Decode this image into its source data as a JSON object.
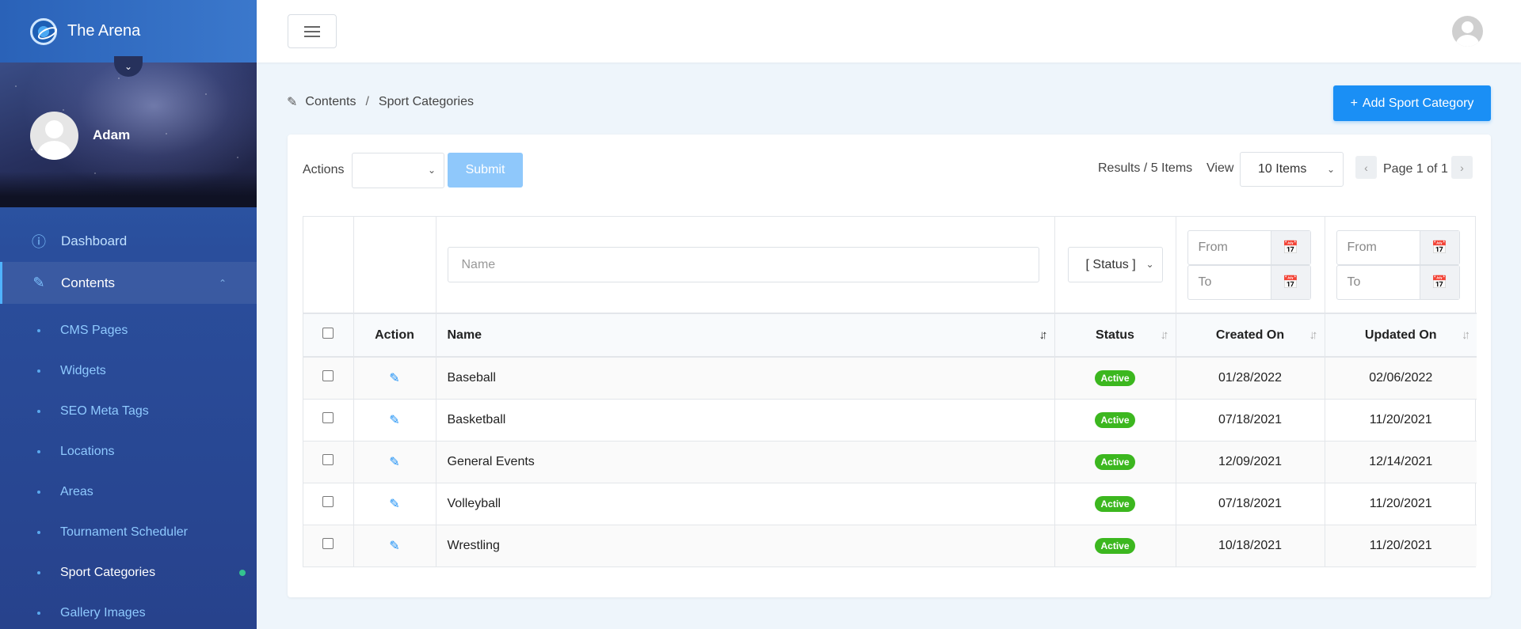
{
  "brand": {
    "name": "The Arena"
  },
  "profile": {
    "name": "Adam"
  },
  "nav": {
    "dashboard": "Dashboard",
    "contents": "Contents",
    "sub_items": [
      "CMS Pages",
      "Widgets",
      "SEO Meta Tags",
      "Locations",
      "Areas",
      "Tournament Scheduler",
      "Sport Categories",
      "Gallery Images"
    ],
    "current_sub": "Sport Categories"
  },
  "breadcrumb": {
    "root": "Contents",
    "sep": "/",
    "current": "Sport Categories"
  },
  "add_button": {
    "label": "Add Sport Category"
  },
  "toolbar": {
    "actions_label": "Actions",
    "submit_label": "Submit",
    "results": "Results / 5 Items",
    "view_label": "View",
    "view_selected": "10 Items",
    "page_info": "Page 1 of 1"
  },
  "filters": {
    "name_placeholder": "Name",
    "status_selected": "[ Status ]",
    "from": "From",
    "to": "To"
  },
  "columns": {
    "action": "Action",
    "name": "Name",
    "status": "Status",
    "created": "Created On",
    "updated": "Updated On"
  },
  "rows": [
    {
      "name": "Baseball",
      "status": "Active",
      "created": "01/28/2022",
      "updated": "02/06/2022"
    },
    {
      "name": "Basketball",
      "status": "Active",
      "created": "07/18/2021",
      "updated": "11/20/2021"
    },
    {
      "name": "General Events",
      "status": "Active",
      "created": "12/09/2021",
      "updated": "12/14/2021"
    },
    {
      "name": "Volleyball",
      "status": "Active",
      "created": "07/18/2021",
      "updated": "11/20/2021"
    },
    {
      "name": "Wrestling",
      "status": "Active",
      "created": "10/18/2021",
      "updated": "11/20/2021"
    }
  ],
  "colors": {
    "primary": "#1a8ff5",
    "active_badge": "#3cb71f",
    "sidebar": "#2a4e9c"
  }
}
